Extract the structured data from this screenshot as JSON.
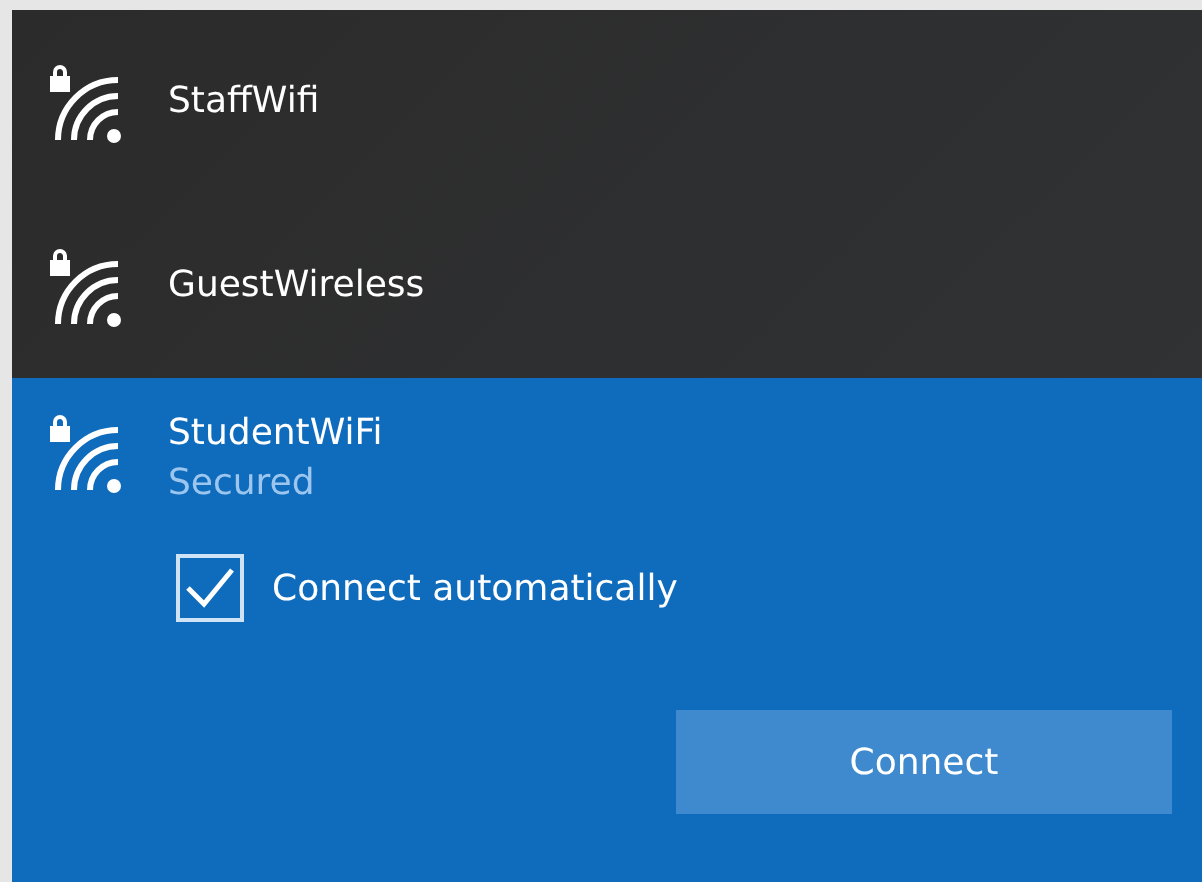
{
  "networks": [
    {
      "name": "StaffWifi",
      "secured": true,
      "selected": false
    },
    {
      "name": "GuestWireless",
      "secured": true,
      "selected": false
    },
    {
      "name": "StudentWiFi",
      "secured": true,
      "selected": true,
      "status": "Secured",
      "auto_connect": {
        "label": "Connect automatically",
        "checked": true
      },
      "button": "Connect"
    }
  ]
}
